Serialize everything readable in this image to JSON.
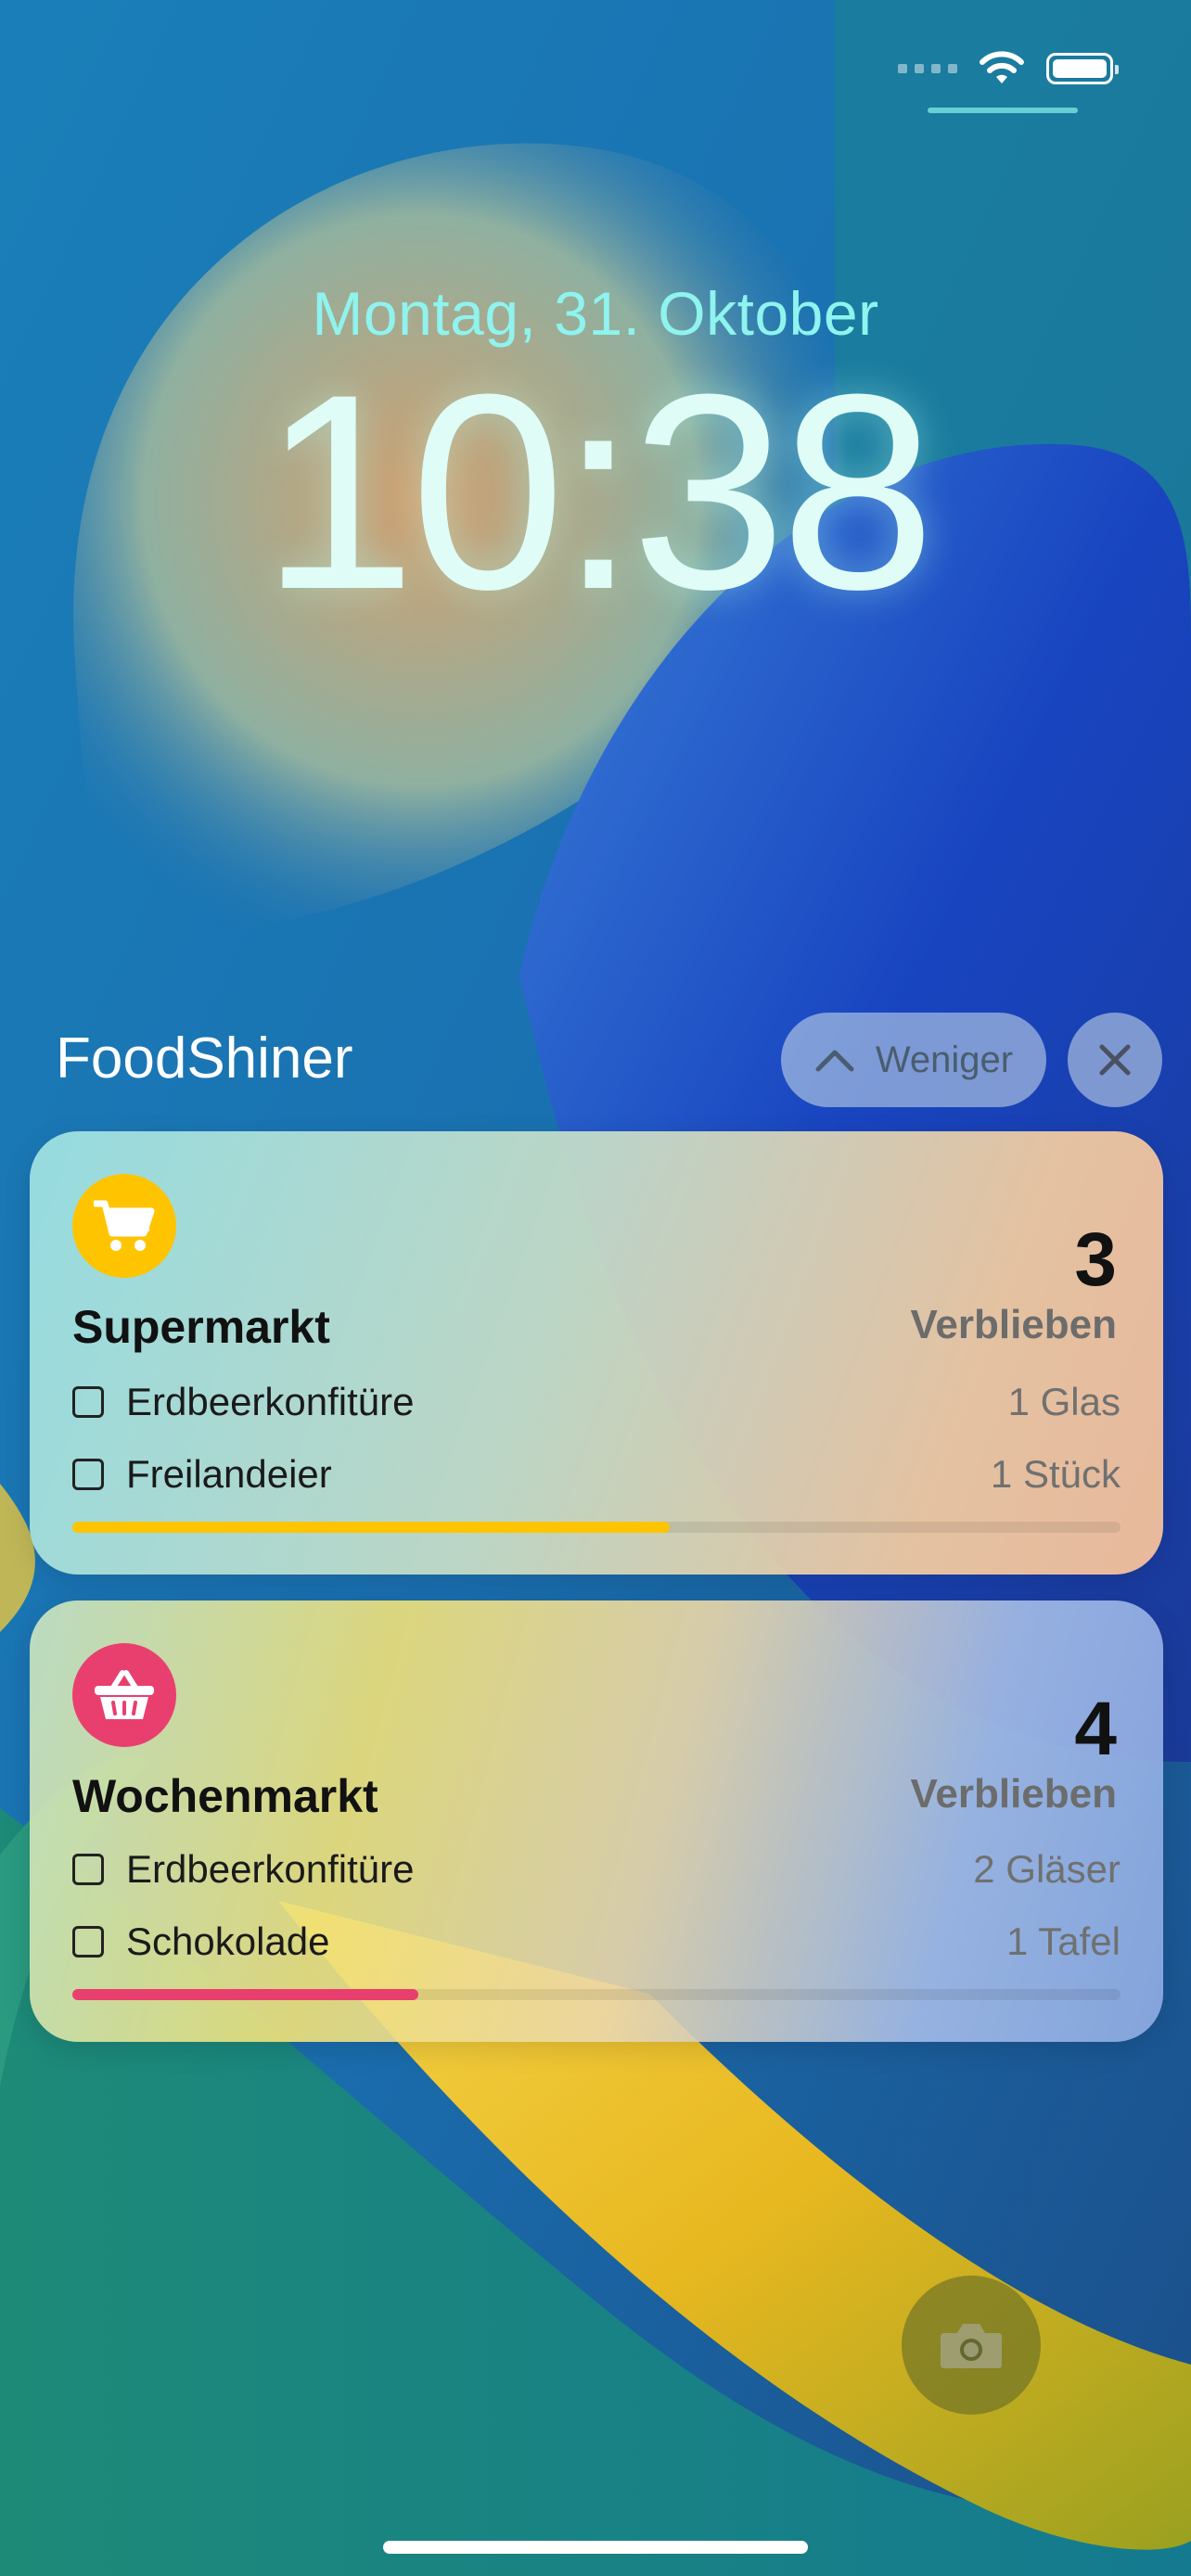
{
  "lockscreen": {
    "date": "Montag, 31. Oktober",
    "time": "10:38"
  },
  "notification_group": {
    "app_name": "FoodShiner",
    "less_button_label": "Weniger"
  },
  "cards": [
    {
      "title": "Supermarkt",
      "count": "3",
      "remaining_label": "Verblieben",
      "icon": "shopping-cart-icon",
      "accent_color": "#FFC400",
      "progress": 0.57,
      "items": [
        {
          "name": "Erdbeerkonfitüre",
          "qty": "1 Glas"
        },
        {
          "name": "Freilandeier",
          "qty": "1 Stück"
        }
      ]
    },
    {
      "title": "Wochenmarkt",
      "count": "4",
      "remaining_label": "Verblieben",
      "icon": "basket-icon",
      "accent_color": "#E93F6E",
      "progress": 0.33,
      "items": [
        {
          "name": "Erdbeerkonfitüre",
          "qty": "2 Gläser"
        },
        {
          "name": "Schokolade",
          "qty": "1 Tafel"
        }
      ]
    }
  ]
}
